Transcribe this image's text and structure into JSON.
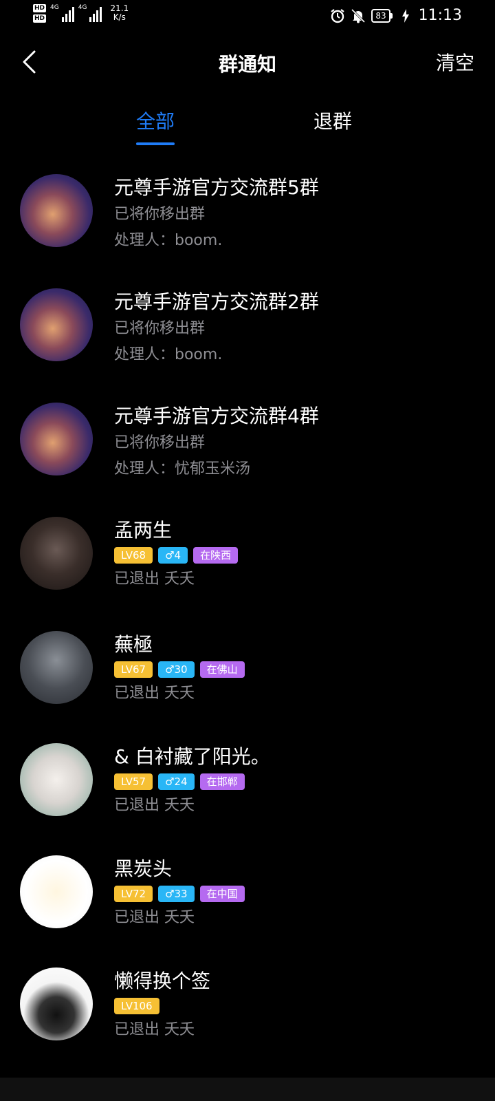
{
  "status_bar": {
    "hd1": "HD",
    "hd2": "HD",
    "net1": "4G",
    "net2": "4G",
    "speed_value": "21.1",
    "speed_unit": "K/s",
    "battery": "83",
    "time": "11:13"
  },
  "header": {
    "title": "群通知",
    "clear_label": "清空"
  },
  "tabs": [
    {
      "label": "全部",
      "active": true
    },
    {
      "label": "退群",
      "active": false
    }
  ],
  "items": [
    {
      "name": "元尊手游官方交流群5群",
      "line1": "已将你移出群",
      "line2": "处理人：boom."
    },
    {
      "name": "元尊手游官方交流群2群",
      "line1": "已将你移出群",
      "line2": "处理人：boom."
    },
    {
      "name": "元尊手游官方交流群4群",
      "line1": "已将你移出群",
      "line2": "处理人：忧郁玉米汤"
    },
    {
      "name": "孟两生",
      "level": "LV68",
      "gender_age": "♂4",
      "location": "在陕西",
      "status": "已退出 夭夭"
    },
    {
      "name": "蕪極",
      "level": "LV67",
      "gender_age": "♂30",
      "location": "在佛山",
      "status": "已退出 夭夭"
    },
    {
      "name": "& 白衬藏了阳光。",
      "level": "LV57",
      "gender_age": "♂24",
      "location": "在邯郸",
      "status": "已退出 夭夭"
    },
    {
      "name": "黑炭头",
      "level": "LV72",
      "gender_age": "♂33",
      "location": "在中国",
      "status": "已退出 夭夭"
    },
    {
      "name": "懒得换个签",
      "level": "LV106",
      "status": "已退出 夭夭"
    }
  ],
  "colors": {
    "accent": "#1f7cf7",
    "level_badge": "#f6c034",
    "gender_badge": "#29b6f6",
    "location_badge": "#b56af0"
  }
}
